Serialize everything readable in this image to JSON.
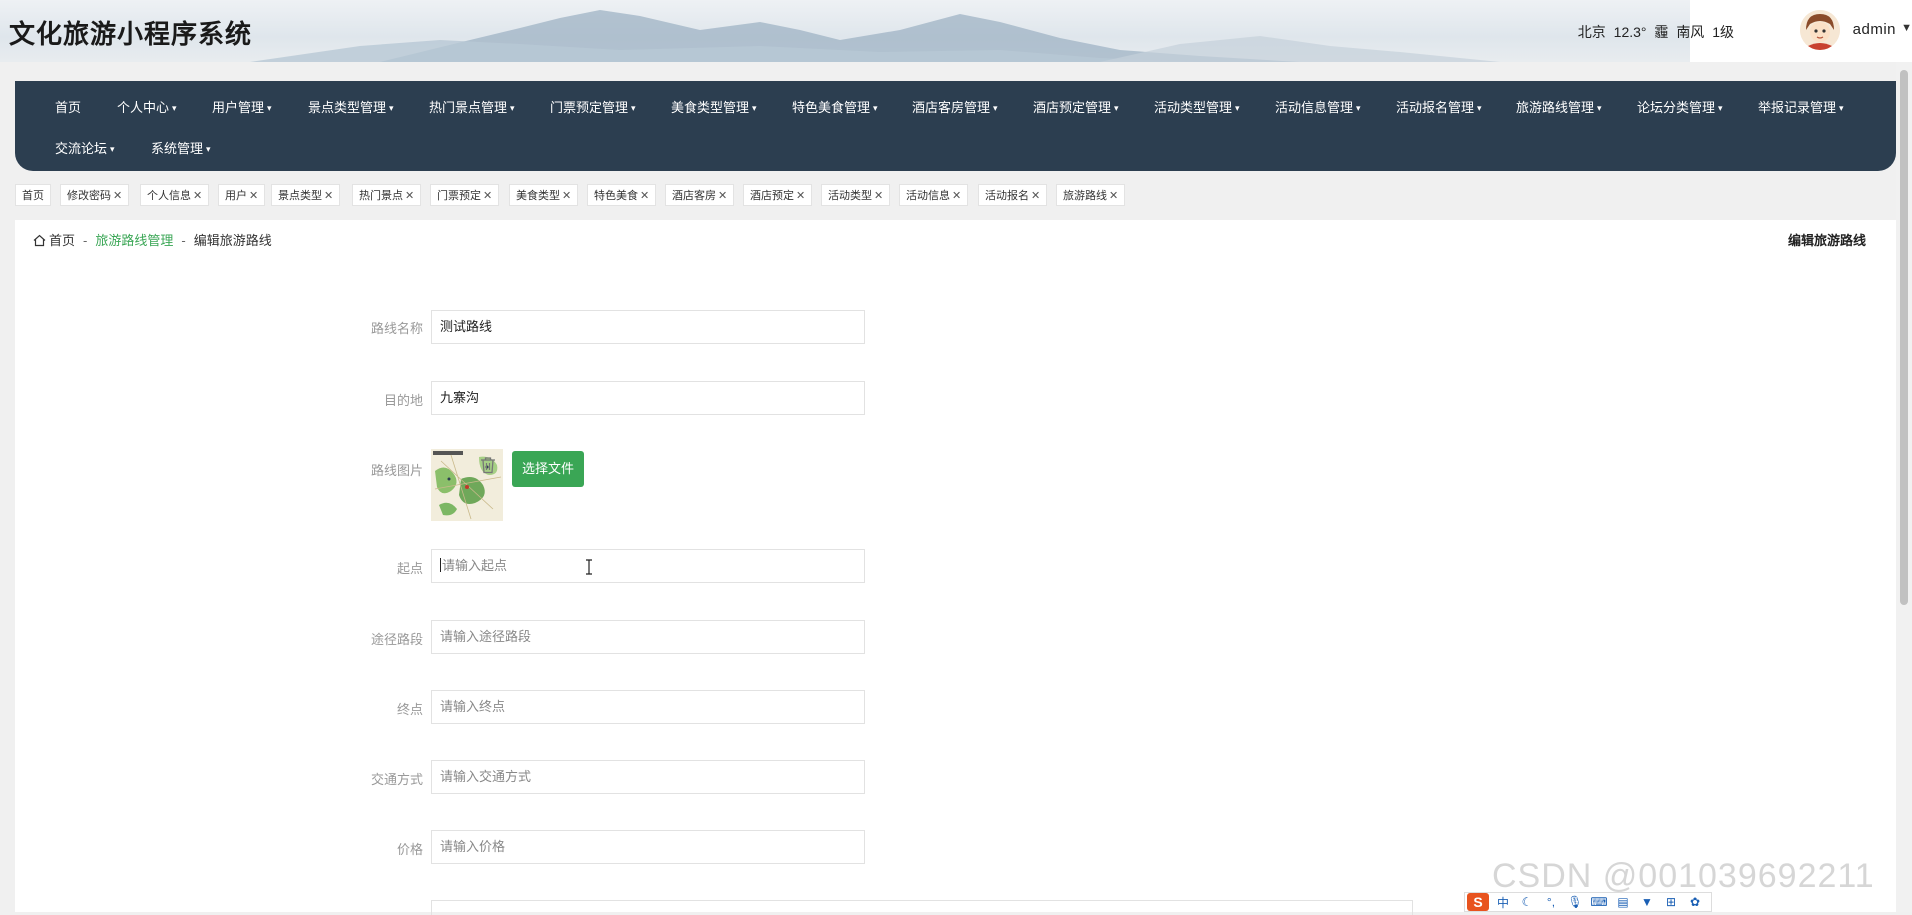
{
  "app": {
    "title": "文化旅游小程序系统"
  },
  "header": {
    "weather": {
      "city": "北京",
      "temp": "12.3°",
      "condition": "霾",
      "wind": "南风",
      "level": "1级"
    },
    "username": "admin"
  },
  "nav": {
    "items": [
      "首页",
      "个人中心",
      "用户管理",
      "景点类型管理",
      "热门景点管理",
      "门票预定管理",
      "美食类型管理",
      "特色美食管理",
      "酒店客房管理",
      "酒店预定管理",
      "活动类型管理",
      "活动信息管理",
      "活动报名管理",
      "旅游路线管理",
      "论坛分类管理",
      "举报记录管理",
      "交流论坛",
      "系统管理"
    ],
    "caret": "▾"
  },
  "tabs": {
    "items": [
      "首页",
      "修改密码",
      "个人信息",
      "用户",
      "景点类型",
      "热门景点",
      "门票预定",
      "美食类型",
      "特色美食",
      "酒店客房",
      "酒店预定",
      "活动类型",
      "活动信息",
      "活动报名",
      "旅游路线"
    ],
    "close": "✕"
  },
  "breadcrumb": {
    "home": "首页",
    "section": "旅游路线管理",
    "current": "编辑旅游路线",
    "separator": "-"
  },
  "page": {
    "title_right": "编辑旅游路线"
  },
  "form": {
    "route_name": {
      "label": "路线名称",
      "value": "测试路线"
    },
    "destination": {
      "label": "目的地",
      "value": "九寨沟"
    },
    "image": {
      "label": "路线图片",
      "button": "选择文件"
    },
    "start": {
      "label": "起点",
      "placeholder": "请输入起点"
    },
    "waypoints": {
      "label": "途径路段",
      "placeholder": "请输入途径路段"
    },
    "end": {
      "label": "终点",
      "placeholder": "请输入终点"
    },
    "transport": {
      "label": "交通方式",
      "placeholder": "请输入交通方式"
    },
    "price": {
      "label": "价格",
      "placeholder": "请输入价格"
    }
  },
  "watermark": "CSDN @001039692211",
  "ime": {
    "logo": "S",
    "mode": "中"
  },
  "colors": {
    "nav_bg": "#2c3e50",
    "accent": "#3aa655"
  }
}
